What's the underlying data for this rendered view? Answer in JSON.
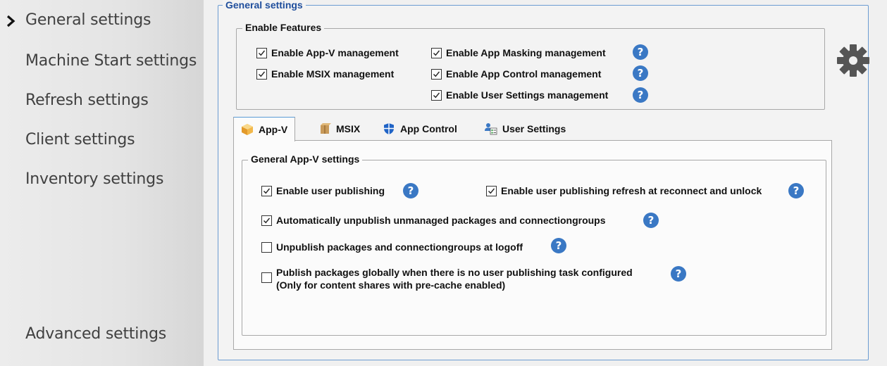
{
  "sidebar": {
    "items": [
      {
        "label": "General settings",
        "selected": true
      },
      {
        "label": "Machine Start settings"
      },
      {
        "label": "Refresh settings"
      },
      {
        "label": "Client settings"
      },
      {
        "label": "Inventory settings"
      }
    ],
    "bottom_item": {
      "label": "Advanced settings"
    }
  },
  "general": {
    "title": "General settings",
    "enable_features": {
      "title": "Enable Features",
      "options": [
        {
          "label": "Enable App-V management",
          "checked": true
        },
        {
          "label": "Enable MSIX management",
          "checked": true
        },
        {
          "label": "Enable App Masking management",
          "checked": true
        },
        {
          "label": "Enable App Control management",
          "checked": true
        },
        {
          "label": "Enable User Settings management",
          "checked": true
        }
      ]
    }
  },
  "tabs": [
    {
      "label": "App-V",
      "icon": "appv-package-icon",
      "active": true
    },
    {
      "label": "MSIX",
      "icon": "msix-box-icon"
    },
    {
      "label": "App Control",
      "icon": "shield-icon"
    },
    {
      "label": "User Settings",
      "icon": "user-settings-icon"
    }
  ],
  "appv": {
    "group_title": "General App-V settings",
    "options": [
      {
        "label": "Enable user publishing",
        "checked": true
      },
      {
        "label": "Enable user publishing refresh at reconnect and unlock",
        "checked": true
      },
      {
        "label": "Automatically unpublish unmanaged packages and connectiongroups",
        "checked": true
      },
      {
        "label": "Unpublish packages and connectiongroups at logoff",
        "checked": false
      },
      {
        "label_line1": "Publish packages globally when there is no user publishing task configured",
        "label_line2": "(Only for content shares with pre-cache enabled)",
        "checked": false
      }
    ]
  },
  "help_glyph": "?",
  "colors": {
    "accent": "#3a78c4",
    "legend_blue": "#1f4e9c",
    "border_blue": "#6b9bd1"
  }
}
